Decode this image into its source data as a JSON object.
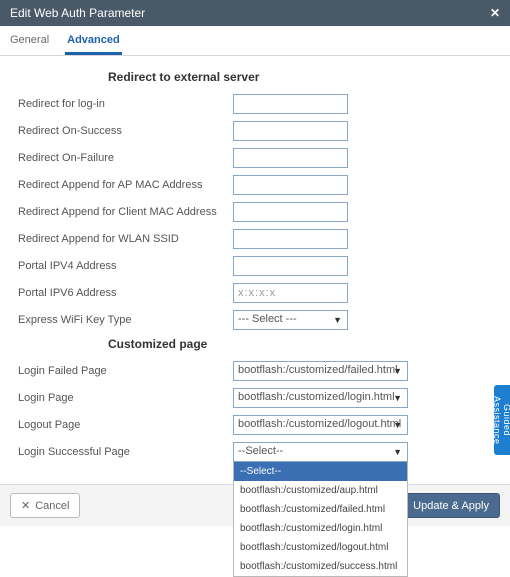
{
  "header": {
    "title": "Edit Web Auth Parameter"
  },
  "tabs": {
    "general": "General",
    "advanced": "Advanced"
  },
  "sections": {
    "redirect_title": "Redirect to external server",
    "customized_title": "Customized page"
  },
  "labels": {
    "redirect_login": "Redirect for log-in",
    "redirect_onsuccess": "Redirect On-Success",
    "redirect_onfailure": "Redirect On-Failure",
    "redirect_ap_mac": "Redirect Append for AP MAC Address",
    "redirect_client_mac": "Redirect Append for Client MAC Address",
    "redirect_wlan_ssid": "Redirect Append for WLAN SSID",
    "portal_ipv4": "Portal IPV4 Address",
    "portal_ipv6": "Portal IPV6 Address",
    "express_wifi": "Express WiFi Key Type",
    "login_failed": "Login Failed Page",
    "login_page": "Login Page",
    "logout_page": "Logout Page",
    "login_success": "Login Successful Page"
  },
  "values": {
    "redirect_login": "",
    "redirect_onsuccess": "",
    "redirect_onfailure": "",
    "redirect_ap_mac": "",
    "redirect_client_mac": "",
    "redirect_wlan_ssid": "",
    "portal_ipv4": "",
    "portal_ipv6": "x:x:x:x",
    "express_wifi": "--- Select ---",
    "login_failed": "bootflash:/customized/failed.html",
    "login_page": "bootflash:/customized/login.html",
    "logout_page": "bootflash:/customized/logout.html",
    "login_success": "--Select--"
  },
  "dropdown_options": [
    "--Select--",
    "bootflash:/customized/aup.html",
    "bootflash:/customized/failed.html",
    "bootflash:/customized/login.html",
    "bootflash:/customized/logout.html",
    "bootflash:/customized/success.html"
  ],
  "footer": {
    "cancel": "Cancel",
    "apply": "Update & Apply"
  },
  "side_tab": "Guided Assistance"
}
